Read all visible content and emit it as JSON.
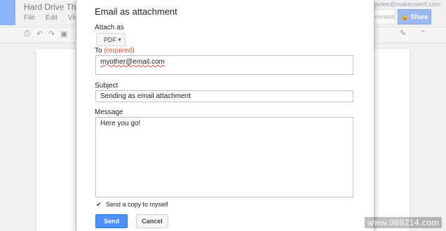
{
  "docs": {
    "title": "Hard Drive Thr",
    "menu": [
      "File",
      "Edit",
      "View"
    ],
    "account": "jsdee@makeuseof.com",
    "comments_label": "Comments",
    "share_label": "Share"
  },
  "dialog": {
    "title": "Email as attachment",
    "attach_label": "Attach as",
    "attach_value": "PDF",
    "to_label": "To",
    "to_required": "(required)",
    "to_value": "myother@email.com",
    "subject_label": "Subject",
    "subject_value": "Sending as email attachment",
    "message_label": "Message",
    "message_value": "Here you go!",
    "copy_label": "Send a copy to myself",
    "copy_checked": true,
    "send_label": "Send",
    "cancel_label": "Cancel"
  },
  "watermark": "www.989214.com",
  "colors": {
    "send": "#4d90fe",
    "required": "#dd4b39"
  }
}
